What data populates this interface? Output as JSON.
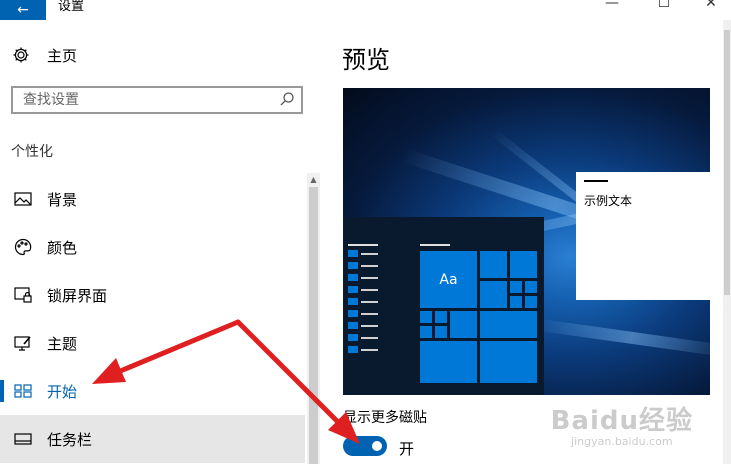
{
  "window": {
    "title": "设置",
    "back_icon": "arrow-left-icon",
    "minimize": "—",
    "maximize": "☐",
    "close": "✕",
    "accent": "#0063b1"
  },
  "sidebar": {
    "home_label": "主页",
    "home_icon": "gear-icon",
    "search_placeholder": "查找设置",
    "search_icon": "search-icon",
    "section_label": "个性化",
    "items": [
      {
        "label": "背景",
        "icon": "image-icon"
      },
      {
        "label": "颜色",
        "icon": "palette-icon"
      },
      {
        "label": "锁屏界面",
        "icon": "lock-screen-icon"
      },
      {
        "label": "主题",
        "icon": "theme-icon"
      },
      {
        "label": "开始",
        "icon": "start-menu-icon",
        "active": true
      },
      {
        "label": "任务栏",
        "icon": "taskbar-icon"
      }
    ]
  },
  "main": {
    "title": "预览",
    "sample_text": "示例文本",
    "tile_text": "Aa",
    "setting_label": "显示更多磁贴",
    "toggle_on": true,
    "toggle_state_label": "开"
  },
  "watermark": {
    "main": "Baidu经验",
    "sub": "jingyan.baidu.com"
  }
}
